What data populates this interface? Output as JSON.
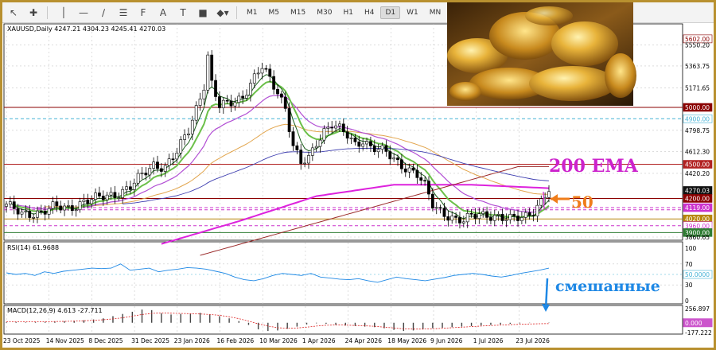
{
  "toolbar": {
    "icons": [
      "cursor-icon",
      "crosshair-icon",
      "vertical-line-icon",
      "horizontal-line-icon",
      "trend-line-icon",
      "equidistant-channel-icon",
      "fibonacci-icon",
      "text-icon",
      "label-icon",
      "rectangle-icon",
      "shapes-icon"
    ],
    "timeframes": [
      "M1",
      "M5",
      "M15",
      "M30",
      "H1",
      "H4",
      "D1",
      "W1",
      "MN"
    ],
    "active_timeframe": "D1"
  },
  "chart_data": [
    {
      "type": "candlestick",
      "title": "XAUUSD,Daily  4247.21 4304.23 4245.41 4270.03",
      "ylim": [
        3860.65,
        5650
      ],
      "price_labels": [
        {
          "value": 5602.0,
          "text": "5602.00",
          "bg": "#ffffff",
          "fg": "#8b0000",
          "border": "#8b0000"
        },
        {
          "value": 5550.2,
          "text": "5550.20"
        },
        {
          "value": 5363.75,
          "text": "5363.75"
        },
        {
          "value": 5171.65,
          "text": "5171.65"
        },
        {
          "value": 5000.0,
          "text": "5000.00",
          "bg": "#8b0000",
          "fg": "#ffffff"
        },
        {
          "value": 4900.0,
          "text": "4900.00",
          "bg": "#ffffff",
          "fg": "#45b2d6",
          "border": "#45b2d6"
        },
        {
          "value": 4798.75,
          "text": "4798.75"
        },
        {
          "value": 4612.3,
          "text": "4612.30"
        },
        {
          "value": 4500.0,
          "text": "4500.00",
          "bg": "#b22222",
          "fg": "#ffffff"
        },
        {
          "value": 4420.2,
          "text": "4420.20"
        },
        {
          "value": 4270.03,
          "text": "4270.03",
          "bg": "#111111",
          "fg": "#ffffff"
        },
        {
          "value": 4200.0,
          "text": "4200.00",
          "bg": "#8b0000",
          "fg": "#ffffff"
        },
        {
          "value": 4119.0,
          "text": "4119.00",
          "bg": "#cc33cc",
          "fg": "#ffffff"
        },
        {
          "value": 4020.0,
          "text": "4020.00",
          "bg": "#b8860b",
          "fg": "#ffffff"
        },
        {
          "value": 3960.0,
          "text": "3960.00",
          "bg": "#ffffff",
          "fg": "#cc33cc",
          "border": "#cc33cc"
        },
        {
          "value": 3900.0,
          "text": "3900.00",
          "bg": "#2e7d32",
          "fg": "#ffffff"
        },
        {
          "value": 3860.65,
          "text": "3860.65"
        }
      ],
      "horizontal_levels": [
        {
          "value": 5000,
          "color": "#8b0000",
          "style": "solid"
        },
        {
          "value": 4900,
          "color": "#45b2d6",
          "style": "dashed"
        },
        {
          "value": 4500,
          "color": "#b22222",
          "style": "solid"
        },
        {
          "value": 4200,
          "color": "#8b0000",
          "style": "solid"
        },
        {
          "value": 4119,
          "color": "#cc33cc",
          "style": "dashed"
        },
        {
          "value": 4100,
          "color": "#cc33cc",
          "style": "dashed"
        },
        {
          "value": 4020,
          "color": "#b8860b",
          "style": "solid"
        },
        {
          "value": 3960,
          "color": "#cc33cc",
          "style": "dashed"
        },
        {
          "value": 3900,
          "color": "#2e7d32",
          "style": "solid"
        }
      ],
      "date_labels": [
        "23 Oct 2025",
        "14 Nov 2025",
        "8 Dec 2025",
        "31 Dec 2025",
        "23 Jan 2026",
        "16 Feb 2026",
        "10 Mar 2026",
        "1 Apr 2026",
        "24 Apr 2026",
        "18 May 2026",
        "9 Jun 2026",
        "1 Jul 2026",
        "23 Jul 2026"
      ],
      "price_path": [
        [
          0,
          4150
        ],
        [
          4,
          4050
        ],
        [
          8,
          4080
        ],
        [
          12,
          4120
        ],
        [
          16,
          4110
        ],
        [
          20,
          4180
        ],
        [
          24,
          4200
        ],
        [
          28,
          4240
        ],
        [
          32,
          4300
        ],
        [
          35,
          4400
        ],
        [
          38,
          4500
        ],
        [
          41,
          4480
        ],
        [
          44,
          4600
        ],
        [
          47,
          4800
        ],
        [
          49,
          5000
        ],
        [
          51,
          5200
        ],
        [
          52,
          5450
        ],
        [
          53,
          5200
        ],
        [
          55,
          5000
        ],
        [
          58,
          5050
        ],
        [
          61,
          5100
        ],
        [
          64,
          5250
        ],
        [
          66,
          5350
        ],
        [
          68,
          5250
        ],
        [
          70,
          5150
        ],
        [
          72,
          5000
        ],
        [
          74,
          4650
        ],
        [
          76,
          4500
        ],
        [
          78,
          4550
        ],
        [
          80,
          4700
        ],
        [
          82,
          4800
        ],
        [
          84,
          4850
        ],
        [
          86,
          4800
        ],
        [
          88,
          4750
        ],
        [
          90,
          4680
        ],
        [
          92,
          4720
        ],
        [
          94,
          4650
        ],
        [
          96,
          4620
        ],
        [
          98,
          4600
        ],
        [
          100,
          4550
        ],
        [
          102,
          4500
        ],
        [
          104,
          4450
        ],
        [
          106,
          4400
        ],
        [
          108,
          4300
        ],
        [
          110,
          4150
        ],
        [
          112,
          4100
        ],
        [
          114,
          4050
        ],
        [
          116,
          4000
        ],
        [
          118,
          3990
        ],
        [
          120,
          4050
        ],
        [
          122,
          4080
        ],
        [
          124,
          4060
        ],
        [
          126,
          4030
        ],
        [
          128,
          4010
        ],
        [
          130,
          4020
        ],
        [
          132,
          4050
        ],
        [
          134,
          4060
        ],
        [
          136,
          4080
        ],
        [
          138,
          4150
        ],
        [
          140,
          4270
        ]
      ],
      "ema200_path": [
        [
          40,
          3800
        ],
        [
          60,
          4000
        ],
        [
          80,
          4220
        ],
        [
          100,
          4320
        ],
        [
          120,
          4320
        ],
        [
          140,
          4290
        ]
      ],
      "annotations": [
        {
          "text": "200 EMA",
          "color": "#cc22cc"
        },
        {
          "text": "50",
          "color": "#ef7d1a"
        }
      ]
    },
    {
      "type": "line",
      "title": "RSI(14) 61.9688",
      "ylim": [
        0,
        100
      ],
      "levels": [
        70,
        50,
        30
      ],
      "level_labels": [
        "100",
        "70",
        "50.0000",
        "30",
        "0"
      ],
      "values": [
        53,
        50,
        52,
        48,
        55,
        52,
        56,
        58,
        60,
        62,
        61,
        62,
        70,
        58,
        60,
        62,
        55,
        58,
        60,
        63,
        62,
        60,
        56,
        52,
        45,
        40,
        38,
        42,
        48,
        52,
        50,
        48,
        52,
        45,
        43,
        41,
        40,
        42,
        38,
        35,
        40,
        45,
        42,
        40,
        38,
        41,
        44,
        48,
        50,
        52,
        50,
        47,
        45,
        48,
        52,
        55,
        58,
        62
      ],
      "annotation": "смешанные"
    },
    {
      "type": "bar",
      "title": "MACD(12,26,9) 4.613 -27.711",
      "ylim": [
        -177.222,
        256.897
      ],
      "level_labels": [
        "256.897",
        "0.000",
        "-177.222"
      ],
      "values": [
        10,
        12,
        8,
        10,
        15,
        20,
        28,
        35,
        45,
        60,
        80,
        120,
        160,
        200,
        240,
        230,
        170,
        150,
        160,
        170,
        180,
        150,
        120,
        80,
        30,
        -40,
        -120,
        -150,
        -140,
        -110,
        -70,
        -30,
        -10,
        -20,
        -40,
        -50,
        -60,
        -70,
        -80,
        -100,
        -130,
        -150,
        -140,
        -120,
        -100,
        -90,
        -80,
        -70,
        -60,
        -50,
        -40,
        -30,
        -20,
        -10,
        -5,
        0,
        5
      ],
      "signal": [
        20,
        20,
        20,
        20,
        20,
        22,
        25,
        30,
        35,
        45,
        55,
        70,
        90,
        120,
        150,
        170,
        180,
        175,
        170,
        165,
        160,
        150,
        135,
        110,
        75,
        30,
        -20,
        -60,
        -90,
        -100,
        -95,
        -80,
        -60,
        -45,
        -40,
        -42,
        -48,
        -55,
        -65,
        -80,
        -95,
        -110,
        -115,
        -115,
        -110,
        -100,
        -90,
        -80,
        -70,
        -60,
        -50,
        -42,
        -35,
        -28,
        -22,
        -18,
        -15
      ]
    }
  ]
}
